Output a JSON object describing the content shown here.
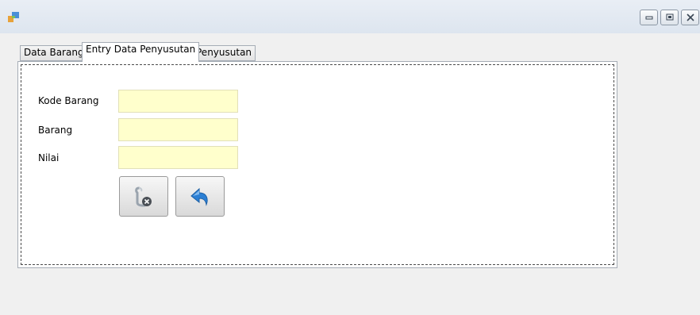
{
  "window": {
    "icons": {
      "app": "app-icon",
      "minimize": "minimize-icon",
      "maximize": "maximize-icon",
      "close": "close-icon"
    }
  },
  "tabs": [
    {
      "label": "Data Barang",
      "active": false
    },
    {
      "label": "Entry Data Penyusutan",
      "active": true
    },
    {
      "label": "Penyusutan",
      "active": false
    }
  ],
  "form": {
    "kode_label": "Kode Barang",
    "kode_value": "",
    "barang_label": "Barang",
    "barang_value": "",
    "nilai_label": "Nilai",
    "nilai_value": "",
    "field_color": "#ffffcc"
  },
  "buttons": {
    "delete_icon": "delete-icon",
    "back_icon": "back-arrow-icon"
  }
}
